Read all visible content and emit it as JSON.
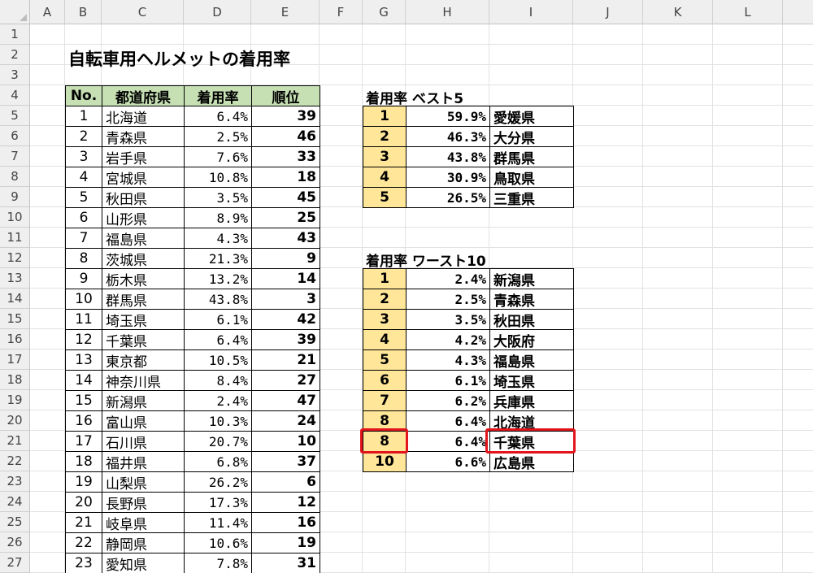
{
  "columns": [
    "A",
    "B",
    "C",
    "D",
    "E",
    "F",
    "G",
    "H",
    "I",
    "J",
    "K",
    "L"
  ],
  "rows": [
    "1",
    "2",
    "3",
    "4",
    "5",
    "6",
    "7",
    "8",
    "9",
    "10",
    "11",
    "12",
    "13",
    "14",
    "15",
    "16",
    "17",
    "18",
    "19",
    "20",
    "21",
    "22",
    "23",
    "24",
    "25",
    "26",
    "27"
  ],
  "title": "自転車用ヘルメットの着用率",
  "main_table": {
    "headers": [
      "No.",
      "都道府県",
      "着用率",
      "順位"
    ],
    "rows": [
      [
        "1",
        "北海道",
        "6.4%",
        "39"
      ],
      [
        "2",
        "青森県",
        "2.5%",
        "46"
      ],
      [
        "3",
        "岩手県",
        "7.6%",
        "33"
      ],
      [
        "4",
        "宮城県",
        "10.8%",
        "18"
      ],
      [
        "5",
        "秋田県",
        "3.5%",
        "45"
      ],
      [
        "6",
        "山形県",
        "8.9%",
        "25"
      ],
      [
        "7",
        "福島県",
        "4.3%",
        "43"
      ],
      [
        "8",
        "茨城県",
        "21.3%",
        "9"
      ],
      [
        "9",
        "栃木県",
        "13.2%",
        "14"
      ],
      [
        "10",
        "群馬県",
        "43.8%",
        "3"
      ],
      [
        "11",
        "埼玉県",
        "6.1%",
        "42"
      ],
      [
        "12",
        "千葉県",
        "6.4%",
        "39"
      ],
      [
        "13",
        "東京都",
        "10.5%",
        "21"
      ],
      [
        "14",
        "神奈川県",
        "8.4%",
        "27"
      ],
      [
        "15",
        "新潟県",
        "2.4%",
        "47"
      ],
      [
        "16",
        "富山県",
        "10.3%",
        "24"
      ],
      [
        "17",
        "石川県",
        "20.7%",
        "10"
      ],
      [
        "18",
        "福井県",
        "6.8%",
        "37"
      ],
      [
        "19",
        "山梨県",
        "26.2%",
        "6"
      ],
      [
        "20",
        "長野県",
        "17.3%",
        "12"
      ],
      [
        "21",
        "岐阜県",
        "11.4%",
        "16"
      ],
      [
        "22",
        "静岡県",
        "10.6%",
        "19"
      ],
      [
        "23",
        "愛知県",
        "7.8%",
        "31"
      ]
    ]
  },
  "best": {
    "title": "着用率 ベスト5",
    "rows": [
      [
        "1",
        "59.9%",
        "愛媛県"
      ],
      [
        "2",
        "46.3%",
        "大分県"
      ],
      [
        "3",
        "43.8%",
        "群馬県"
      ],
      [
        "4",
        "30.9%",
        "鳥取県"
      ],
      [
        "5",
        "26.5%",
        "三重県"
      ]
    ]
  },
  "worst": {
    "title": "着用率 ワースト10",
    "rows": [
      [
        "1",
        "2.4%",
        "新潟県"
      ],
      [
        "2",
        "2.5%",
        "青森県"
      ],
      [
        "3",
        "3.5%",
        "秋田県"
      ],
      [
        "4",
        "4.2%",
        "大阪府"
      ],
      [
        "5",
        "4.3%",
        "福島県"
      ],
      [
        "6",
        "6.1%",
        "埼玉県"
      ],
      [
        "7",
        "6.2%",
        "兵庫県"
      ],
      [
        "8",
        "6.4%",
        "北海道"
      ],
      [
        "8",
        "6.4%",
        "千葉県"
      ],
      [
        "10",
        "6.6%",
        "広島県"
      ]
    ]
  },
  "colors": {
    "header_green": "#c6e0b4",
    "rank_gold": "#ffe699",
    "highlight_red": "#e3151c"
  }
}
